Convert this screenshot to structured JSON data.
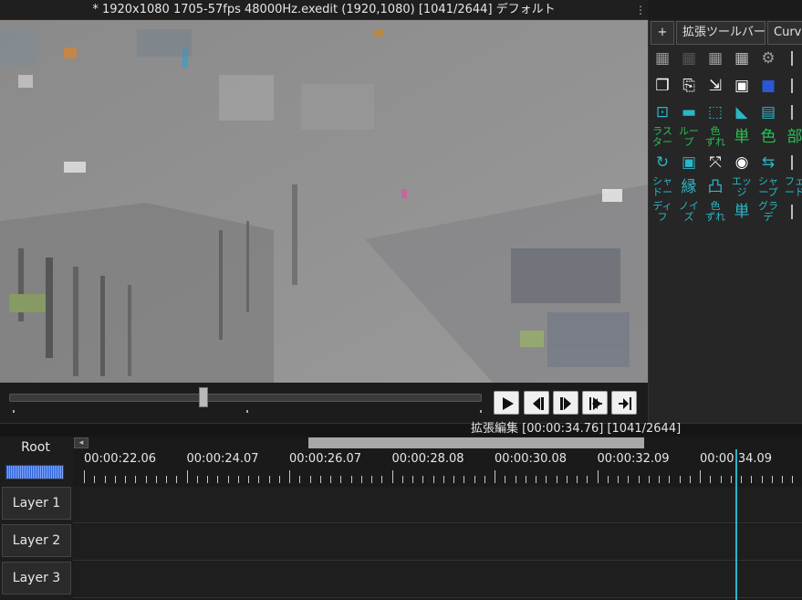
{
  "window": {
    "title": "* 1920x1080  1705-57fps  48000Hz.exedit (1920,1080)  [1041/2644]  デフォルト",
    "menu_dots": "⋮"
  },
  "toolbar": {
    "tabs": [
      {
        "label": "+"
      },
      {
        "label": "拡張ツールバー"
      },
      {
        "label": "Curve"
      }
    ],
    "rows": [
      [
        {
          "name": "grid-icon",
          "glyph": "▦",
          "color": "#9a9a9a"
        },
        {
          "name": "grid-dark-icon",
          "glyph": "▦",
          "color": "#555"
        },
        {
          "name": "grid-perspective-icon",
          "glyph": "▦",
          "color": "#9a9a9a"
        },
        {
          "name": "grid-3d-icon",
          "glyph": "▦",
          "color": "#bbbbbb"
        },
        {
          "name": "gear-icon",
          "glyph": "⚙",
          "color": "#9a9a9a"
        }
      ],
      [
        {
          "name": "copy-icon",
          "glyph": "❐",
          "color": "#ffffff"
        },
        {
          "name": "export-icon",
          "glyph": "⎘",
          "color": "#ffffff"
        },
        {
          "name": "import-icon",
          "glyph": "⇲",
          "color": "#ffffff"
        },
        {
          "name": "object-icon",
          "glyph": "▣",
          "color": "#ffffff"
        },
        {
          "name": "blue-box-icon",
          "glyph": "■",
          "color": "#2b57d6"
        }
      ],
      [
        {
          "name": "frame-icon",
          "glyph": "⊡",
          "color": "#2bb7c6"
        },
        {
          "name": "camera-icon",
          "glyph": "▬",
          "color": "#2bb7c6"
        },
        {
          "name": "select-area-icon",
          "glyph": "⬚",
          "color": "#2bb7c6"
        },
        {
          "name": "cursor-icon",
          "glyph": "◣",
          "color": "#2bb7c6"
        },
        {
          "name": "monitor-icon",
          "glyph": "▤",
          "color": "#2bb7c6"
        }
      ],
      [
        {
          "name": "raster-icon",
          "glyph": "ラス\nター",
          "color": "#2bbf55"
        },
        {
          "name": "loop-icon",
          "glyph": "ルー\nプ",
          "color": "#2bbf55"
        },
        {
          "name": "misalign-icon",
          "glyph": "色\nずれ",
          "color": "#2bbf55"
        },
        {
          "name": "single-color-icon",
          "glyph": "単",
          "color": "#2bbf55"
        },
        {
          "name": "color-shift-icon",
          "glyph": "色",
          "color": "#2bbf55"
        },
        {
          "name": "partial-icon",
          "glyph": "部",
          "color": "#2bbf55"
        }
      ],
      [
        {
          "name": "rotate-icon",
          "glyph": "↻",
          "color": "#2bb7c6"
        },
        {
          "name": "center-icon",
          "glyph": "▣",
          "color": "#2bb7c6"
        },
        {
          "name": "expand-icon",
          "glyph": "⤧",
          "color": "#ffffff"
        },
        {
          "name": "record-icon",
          "glyph": "◉",
          "color": "#ffffff"
        },
        {
          "name": "swap-icon",
          "glyph": "⇆",
          "color": "#2bb7c6"
        }
      ],
      [
        {
          "name": "shadow-icon",
          "glyph": "シャ\nドー",
          "color": "#2bb7c6"
        },
        {
          "name": "border-icon",
          "glyph": "縁",
          "color": "#2bb7c6"
        },
        {
          "name": "emboss-icon",
          "glyph": "凸",
          "color": "#2bb7c6"
        },
        {
          "name": "edge-icon",
          "glyph": "エッ\nジ",
          "color": "#2bb7c6"
        },
        {
          "name": "sharpen-icon",
          "glyph": "シャ\nープ",
          "color": "#2bb7c6"
        },
        {
          "name": "fade-icon",
          "glyph": "フェ\nード",
          "color": "#2bb7c6"
        }
      ],
      [
        {
          "name": "diffuse-icon",
          "glyph": "ディ\nフ",
          "color": "#2bb7c6"
        },
        {
          "name": "noise-icon",
          "glyph": "ノイ\nズ",
          "color": "#2bb7c6"
        },
        {
          "name": "color-misalign-icon",
          "glyph": "色\nずれ",
          "color": "#2bb7c6"
        },
        {
          "name": "mono-icon",
          "glyph": "単",
          "color": "#2bb7c6"
        },
        {
          "name": "gradient-icon",
          "glyph": "グラ\nデ",
          "color": "#2bb7c6"
        }
      ]
    ]
  },
  "timeline": {
    "status": "拡張編集 [00:00:34.76] [1041/2644]",
    "root_label": "Root",
    "scroll_left": "◂",
    "time_labels": [
      "00:00:22.06",
      "00:00:24.07",
      "00:00:26.07",
      "00:00:28.08",
      "00:00:30.08",
      "00:00:32.09",
      "00:00:34.09"
    ],
    "layers": [
      "Layer 1",
      "Layer 2",
      "Layer 3"
    ]
  },
  "seek": {
    "position_fraction": 0.41
  }
}
